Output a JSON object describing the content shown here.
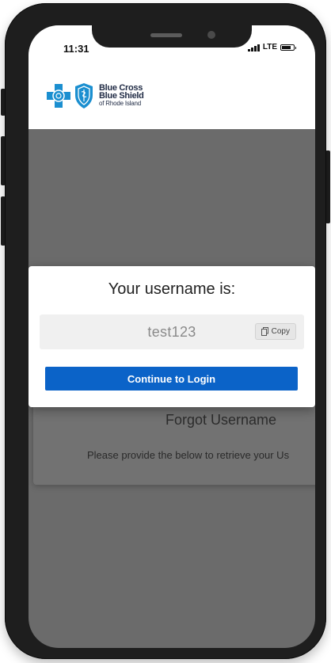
{
  "status_bar": {
    "time": "11:31",
    "network": "LTE"
  },
  "brand": {
    "line1": "Blue Cross",
    "line2": "Blue Shield",
    "line3": "of Rhode Island",
    "colors": {
      "cross": "#1b8fd0",
      "shield": "#1b8fd0",
      "text": "#1f2a44"
    }
  },
  "background_page": {
    "title": "Forgot Username",
    "subtitle": "Please provide the below to retrieve your Us"
  },
  "modal": {
    "title": "Your username is:",
    "username": "test123",
    "copy_label": "Copy",
    "continue_label": "Continue to Login",
    "accent": "#0b63c8"
  },
  "icons": {
    "copy": "copy-icon",
    "cross_logo": "blue-cross-icon",
    "shield_logo": "blue-shield-icon"
  }
}
